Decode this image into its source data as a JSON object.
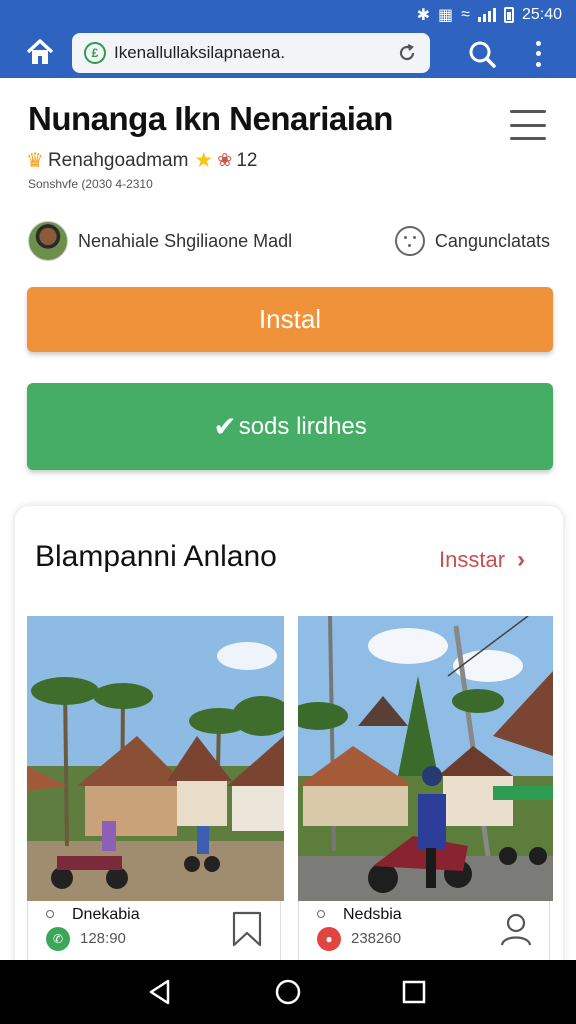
{
  "status_bar": {
    "time": "25:40"
  },
  "browser": {
    "url": "Ikenallullaksilapnaena.",
    "secure_icon": "£"
  },
  "app": {
    "title": "Nunanga Ikn Nenariaian",
    "rating_text": "Renahgoadmam",
    "rating_count": "12",
    "subtext": "Sonshvfe (2030 4-2310",
    "author": "Nenahiale Shgiliaone Madl",
    "contact_label": "Cangunclatats"
  },
  "buttons": {
    "install": "Instal",
    "verify": "sods lirdhes"
  },
  "section": {
    "title": "Blampanni Anlano",
    "link": "Insstar"
  },
  "cards": [
    {
      "name": "Dnekabia",
      "number": "128:90",
      "action_icon": "bookmark-icon"
    },
    {
      "name": "Nedsbia",
      "number": "238260",
      "action_icon": "user-icon"
    }
  ],
  "colors": {
    "browser_bar": "#2f63c0",
    "install": "#f0923a",
    "verify": "#45ad65",
    "link": "#c8504f"
  }
}
